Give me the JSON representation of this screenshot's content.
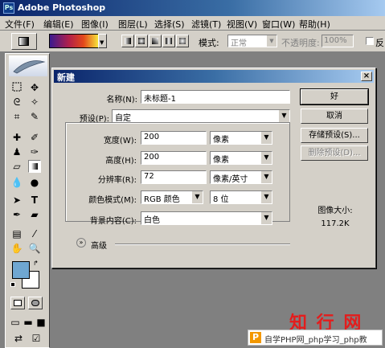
{
  "app": {
    "title": "Adobe Photoshop",
    "ps_icon": "Ps"
  },
  "menu": [
    "文件(F)",
    "编辑(E)",
    "图像(I)",
    "图层(L)",
    "选择(S)",
    "滤镜(T)",
    "视图(V)",
    "窗口(W)",
    "帮助(H)"
  ],
  "options": {
    "mode_label": "模式:",
    "mode_value": "正常",
    "opacity_label": "不透明度:",
    "opacity_value": "100%",
    "reverse_label": "反向"
  },
  "dialog": {
    "title": "新建",
    "close_glyph": "×",
    "name_label": "名称(N):",
    "name_value": "未标题-1",
    "preset_label": "预设(P):",
    "preset_value": "自定",
    "width_label": "宽度(W):",
    "width_value": "200",
    "width_unit": "像素",
    "height_label": "高度(H):",
    "height_value": "200",
    "height_unit": "像素",
    "resolution_label": "分辨率(R):",
    "resolution_value": "72",
    "resolution_unit": "像素/英寸",
    "color_mode_label": "颜色模式(M):",
    "color_mode_value": "RGB 颜色",
    "bit_depth_value": "8 位",
    "background_label": "背景内容(C):",
    "background_value": "白色",
    "advanced_label": "高级",
    "ok_label": "好",
    "cancel_label": "取消",
    "save_preset_label": "存储预设(S)...",
    "delete_preset_label": "删除预设(D)...",
    "image_size_label": "图像大小:",
    "image_size_value": "117.2K"
  },
  "watermark": {
    "logo": "知 行 网",
    "p_icon": "P",
    "text": "自学PHP网_php学习_php教"
  },
  "colors": {
    "foreground": "#6fa7d2",
    "background": "#ffffff",
    "title_bar": "#0a246a",
    "chrome": "#d4d0c8"
  }
}
